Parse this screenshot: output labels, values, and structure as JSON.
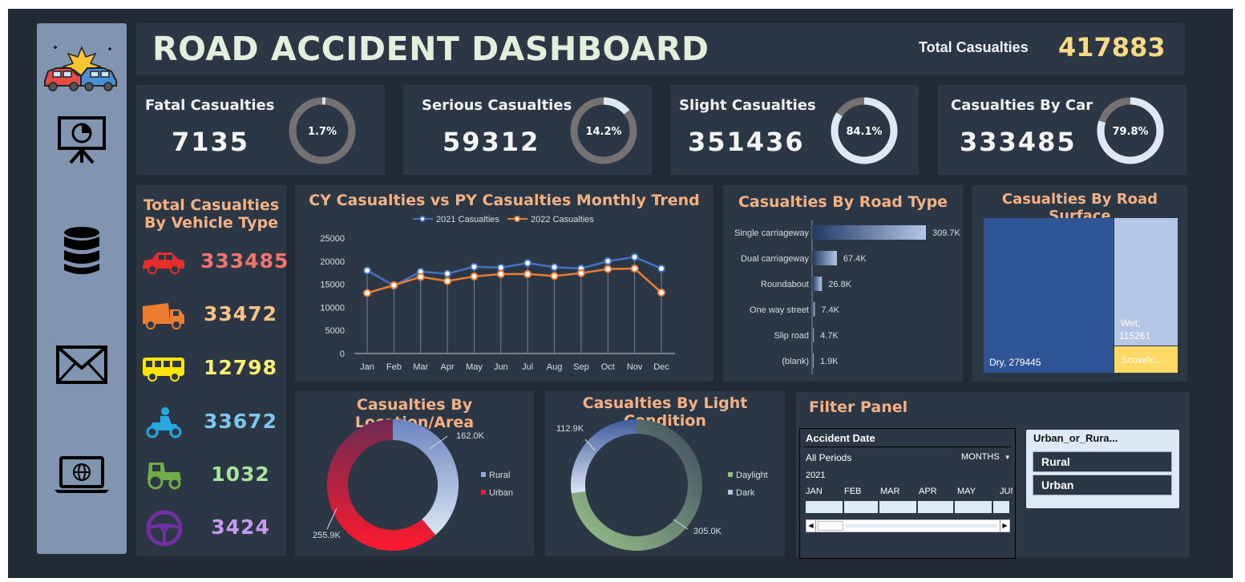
{
  "header": {
    "title": "ROAD ACCIDENT DASHBOARD",
    "total_label": "Total Casualties",
    "total_value": "417883"
  },
  "sidebar": {
    "icons": [
      "car-crash-icon",
      "presentation-icon",
      "database-icon",
      "mail-icon",
      "laptop-globe-icon"
    ]
  },
  "kpis": [
    {
      "label": "Fatal Casualties",
      "value": "7135",
      "pct_label": "1.7%",
      "pct": 0.017
    },
    {
      "label": "Serious Casualties",
      "value": "59312",
      "pct_label": "14.2%",
      "pct": 0.142
    },
    {
      "label": "Slight Casualties",
      "value": "351436",
      "pct_label": "84.1%",
      "pct": 0.841
    },
    {
      "label": "Casualties By Car",
      "value": "333485",
      "pct_label": "79.8%",
      "pct": 0.798
    }
  ],
  "vehicle": {
    "title_line1": "Total Casualties",
    "title_line2": "By Vehicle Type",
    "items": [
      {
        "icon": "car-icon",
        "value": "333485",
        "color": "#f4736f"
      },
      {
        "icon": "truck-icon",
        "value": "33472",
        "color": "#f6c483"
      },
      {
        "icon": "bus-icon",
        "value": "12798",
        "color": "#fff06d"
      },
      {
        "icon": "motorbike-icon",
        "value": "33672",
        "color": "#7fc7ef"
      },
      {
        "icon": "tractor-icon",
        "value": "1032",
        "color": "#a8e5a0"
      },
      {
        "icon": "steering-wheel-icon",
        "value": "3424",
        "color": "#c79af0"
      }
    ]
  },
  "chart_data": [
    {
      "type": "line",
      "title": "CY Casualties vs PY Casualties Monthly Trend",
      "categories": [
        "Jan",
        "Feb",
        "Mar",
        "Apr",
        "May",
        "Jun",
        "Jul",
        "Aug",
        "Sep",
        "Oct",
        "Nov",
        "Dec"
      ],
      "series": [
        {
          "name": "2021 Casualties",
          "color": "#4472c4",
          "values": [
            18000,
            14700,
            17700,
            17300,
            18800,
            18600,
            19600,
            18700,
            18400,
            20000,
            20900,
            18400
          ]
        },
        {
          "name": "2022 Casualties",
          "color": "#ed7d31",
          "values": [
            13100,
            14800,
            16600,
            15700,
            16700,
            17200,
            17200,
            16800,
            17400,
            18300,
            18400,
            13200
          ]
        }
      ],
      "yticks": [
        "25000",
        "20000",
        "15000",
        "10000",
        "5000",
        "0"
      ],
      "ylim": [
        0,
        25000
      ],
      "legend": "top"
    },
    {
      "type": "bar",
      "orientation": "horizontal",
      "title": "Casualties By Road Type",
      "categories": [
        "Single carriageway",
        "Dual carriageway",
        "Roundabout",
        "One way street",
        "Slip road",
        "(blank)"
      ],
      "values": [
        309.7,
        67.4,
        26.8,
        7.4,
        4.7,
        1.9
      ],
      "labels": [
        "309.7K",
        "67.4K",
        "26.8K",
        "7.4K",
        "4.7K",
        "1.9K"
      ]
    },
    {
      "type": "treemap",
      "title": "Casualties By Road Surface",
      "items": [
        {
          "label": "Dry, 279445",
          "value": 279445,
          "color": "#2f5597"
        },
        {
          "label_line1": "Wet,",
          "label_line2": "115261",
          "value": 115261,
          "color": "#b4c7e7"
        },
        {
          "label": "Snow/Ic...",
          "color": "#ffd966"
        }
      ]
    },
    {
      "type": "pie",
      "title": "Casualties By Location/Area",
      "series": [
        {
          "name": "Rural",
          "value": 162.0,
          "label": "162.0K",
          "color": "#8faadc"
        },
        {
          "name": "Urban",
          "value": 255.9,
          "label": "255.9K",
          "color": "#e8213a"
        }
      ],
      "legend": "right"
    },
    {
      "type": "pie",
      "title": "Casualties By Light Condition",
      "series": [
        {
          "name": "Daylight",
          "value": 305.0,
          "label": "305.0K",
          "color": "#8fbf7f"
        },
        {
          "name": "Dark",
          "value": 112.9,
          "label": "112.9K",
          "color": "#b4c7e7"
        }
      ],
      "legend": "right"
    }
  ],
  "filter": {
    "title": "Filter Panel",
    "timeline": {
      "header": "Accident Date",
      "periods": "All Periods",
      "unit": "MONTHS",
      "year": "2021",
      "months": [
        "JAN",
        "FEB",
        "MAR",
        "APR",
        "MAY",
        "JUN"
      ]
    },
    "slicer": {
      "header": "Urban_or_Rura...",
      "options": [
        "Rural",
        "Urban"
      ]
    }
  }
}
